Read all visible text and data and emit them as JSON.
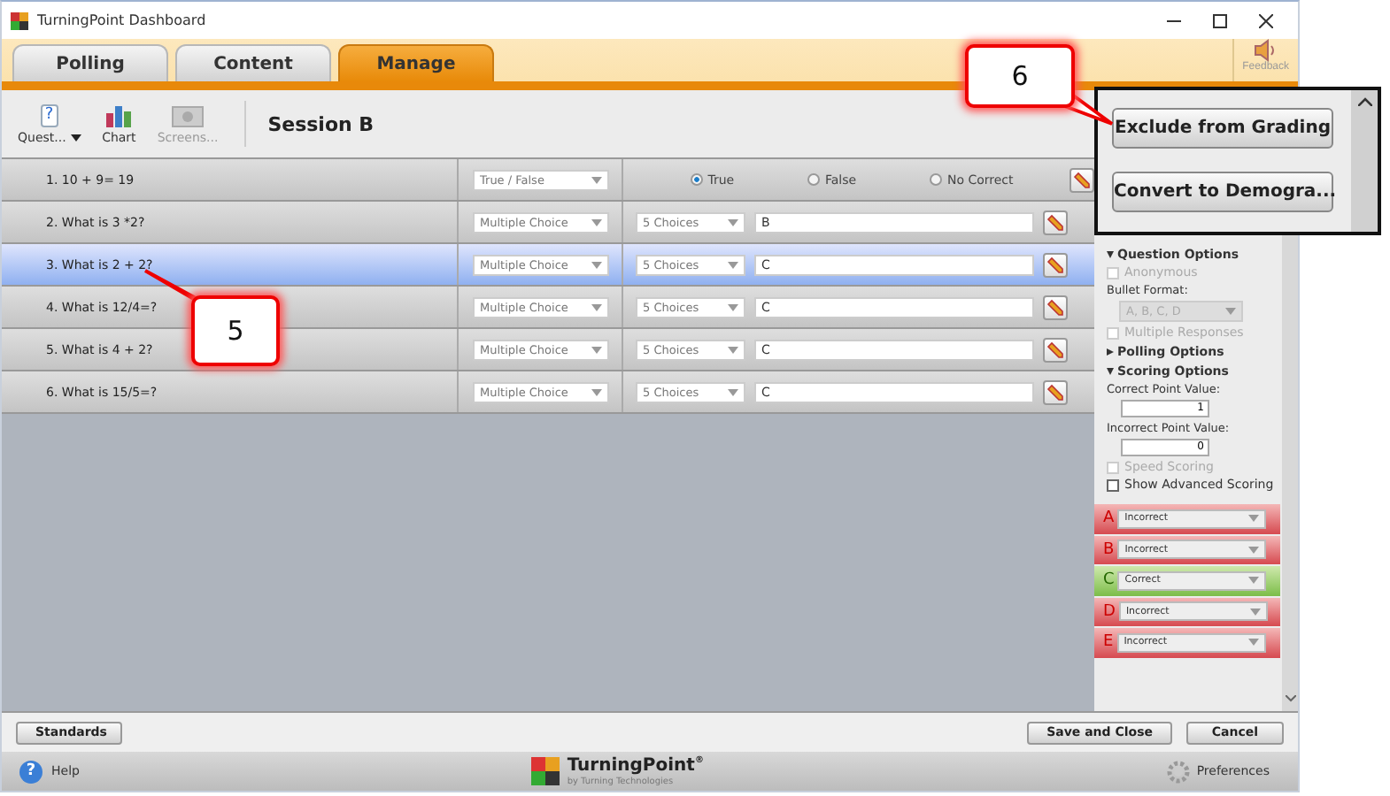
{
  "window": {
    "title": "TurningPoint Dashboard"
  },
  "tabs": [
    {
      "label": "Polling",
      "selected": false
    },
    {
      "label": "Content",
      "selected": false
    },
    {
      "label": "Manage",
      "selected": true
    }
  ],
  "feedback": {
    "label": "Feedback"
  },
  "toolbar": [
    {
      "label": "Quest...",
      "kind": "question",
      "icon_text": "?",
      "disabled": false,
      "dropdown": true
    },
    {
      "label": "Chart",
      "kind": "chart",
      "disabled": false,
      "dropdown": false
    },
    {
      "label": "Screens...",
      "kind": "screens",
      "disabled": true,
      "dropdown": false
    }
  ],
  "session_title": "Session B",
  "questions": [
    {
      "text": "1. 10 + 9= 19",
      "type": "True / False",
      "kind": "true_false",
      "selected": false,
      "options": [
        {
          "label": "True",
          "selected": true
        },
        {
          "label": "False",
          "selected": false
        },
        {
          "label": "No Correct",
          "selected": false
        }
      ]
    },
    {
      "text": "2. What is 3 *2?",
      "type": "Multiple Choice",
      "kind": "multiple",
      "selected": false,
      "choices": "5 Choices",
      "answer": "B"
    },
    {
      "text": "3. What is 2 + 2?",
      "type": "Multiple Choice",
      "kind": "multiple",
      "selected": true,
      "choices": "5 Choices",
      "answer": "C"
    },
    {
      "text": "4. What is 12/4=?",
      "type": "Multiple Choice",
      "kind": "multiple",
      "selected": false,
      "choices": "5 Choices",
      "answer": "C"
    },
    {
      "text": "5. What is 4 + 2?",
      "type": "Multiple Choice",
      "kind": "multiple",
      "selected": false,
      "choices": "5 Choices",
      "answer": "C"
    },
    {
      "text": "6. What is 15/5=?",
      "type": "Multiple Choice",
      "kind": "multiple",
      "selected": false,
      "choices": "5 Choices",
      "answer": "C"
    }
  ],
  "panel": {
    "action_buttons": [
      "Exclude from Grading",
      "Convert to Demogra..."
    ],
    "sections": [
      {
        "label": "Question Options",
        "expanded": true,
        "items": [
          {
            "kind": "checkbox",
            "label": "Anonymous",
            "checked": false,
            "disabled": true
          },
          {
            "kind": "caption",
            "label": "Bullet Format:"
          },
          {
            "kind": "dropdown",
            "value": "A, B, C, D",
            "disabled": true
          },
          {
            "kind": "checkbox",
            "label": "Multiple Responses",
            "checked": false,
            "disabled": true
          }
        ]
      },
      {
        "label": "Polling Options",
        "expanded": false
      },
      {
        "label": "Scoring Options",
        "expanded": true,
        "items": [
          {
            "kind": "caption",
            "label": "Correct Point Value:"
          },
          {
            "kind": "number",
            "value": "1"
          },
          {
            "kind": "caption",
            "label": "Incorrect Point Value:"
          },
          {
            "kind": "number",
            "value": "0"
          },
          {
            "kind": "checkbox",
            "label": "Speed Scoring",
            "checked": false,
            "disabled": true
          },
          {
            "kind": "checkbox",
            "label": "Show Advanced Scoring",
            "checked": false,
            "disabled": false
          }
        ]
      }
    ],
    "answers": [
      {
        "letter": "A",
        "value": "Incorrect",
        "correct": false
      },
      {
        "letter": "B",
        "value": "Incorrect",
        "correct": false
      },
      {
        "letter": "C",
        "value": "Correct",
        "correct": true
      },
      {
        "letter": "D",
        "value": "Incorrect",
        "correct": false
      },
      {
        "letter": "E",
        "value": "Incorrect",
        "correct": false
      }
    ]
  },
  "bottom_bar": {
    "left_button": "Standards",
    "right_buttons": [
      "Save and Close",
      "Cancel"
    ]
  },
  "footer": {
    "help_icon": "?",
    "help": "Help",
    "brand": "TurningPoint",
    "brand_mark": "®",
    "byline": "by Turning Technologies",
    "preferences": "Preferences"
  },
  "callouts": [
    {
      "number": "6"
    },
    {
      "number": "5"
    }
  ]
}
